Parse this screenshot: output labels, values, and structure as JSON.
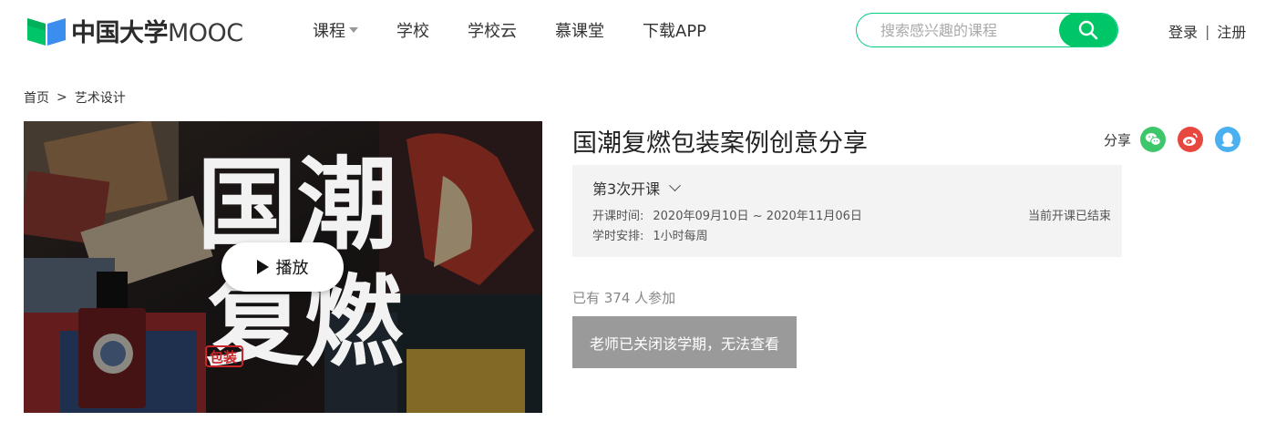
{
  "header": {
    "logo_text": "中国大学",
    "logo_text_latin": "MOOC",
    "nav": [
      {
        "label": "课程",
        "has_dropdown": true
      },
      {
        "label": "学校",
        "has_dropdown": false
      },
      {
        "label": "学校云",
        "has_dropdown": false
      },
      {
        "label": "慕课堂",
        "has_dropdown": false
      },
      {
        "label": "下载APP",
        "has_dropdown": false
      }
    ],
    "search": {
      "placeholder": "搜索感兴趣的课程",
      "icon": "search-icon"
    },
    "auth": {
      "login": "登录",
      "separator": "|",
      "register": "注册"
    }
  },
  "breadcrumb": {
    "home": "首页",
    "separator": ">",
    "current": "艺术设计"
  },
  "cover": {
    "play_label": "播放",
    "art_text_line1": "国潮",
    "art_text_line2": "复燃",
    "stamp_text": "包装"
  },
  "course": {
    "title": "国潮复燃包装案例创意分享",
    "share": {
      "label": "分享",
      "icons": [
        "wechat-icon",
        "weibo-icon",
        "qq-icon"
      ],
      "colors": {
        "wechat": "#3ec66a",
        "weibo": "#e8473f",
        "qq": "#4ab0f0"
      }
    },
    "term": {
      "selected": "第3次开课",
      "time_label": "开课时间:",
      "time_value": "2020年09月10日 ~ 2020年11月06日",
      "schedule_label": "学时安排:",
      "schedule_value": "1小时每周",
      "status": "当前开课已结束"
    },
    "enrolled_text": "已有 374 人参加",
    "closed_button": "老师已关闭该学期，无法查看"
  },
  "colors": {
    "accent": "#00c667",
    "button_disabled": "#9a9a9a",
    "term_bg": "#f3f3f3"
  }
}
